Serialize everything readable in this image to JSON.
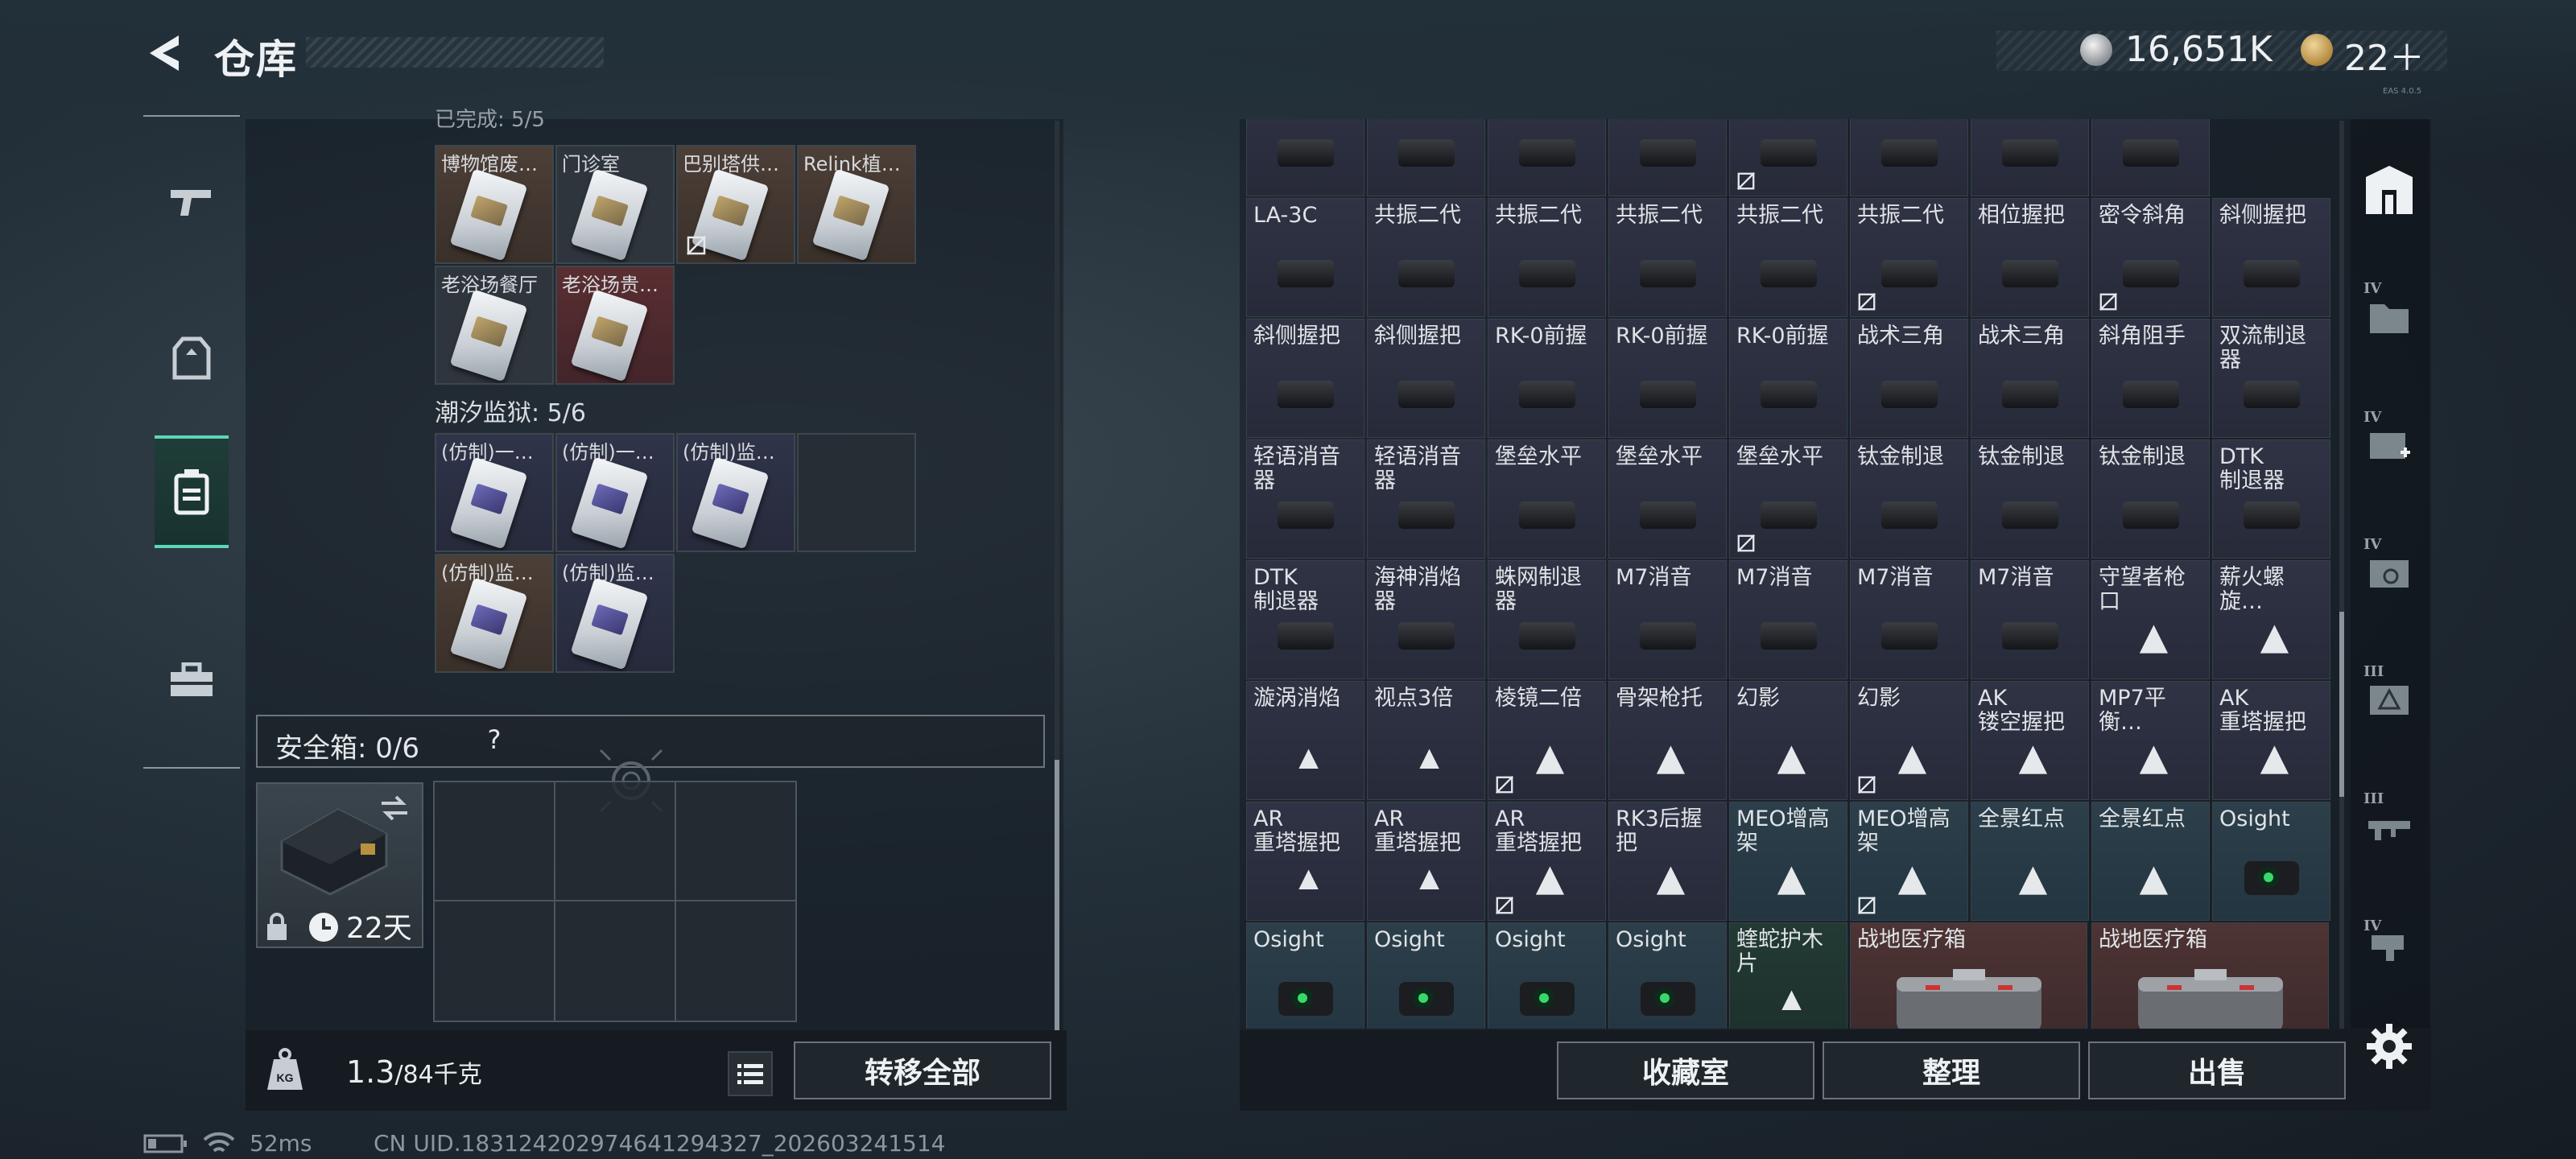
{
  "header": {
    "title": "仓库",
    "money": "16,651K",
    "gold": "22＋",
    "tiny_tag": "EAS 4.0.5"
  },
  "left_nav": {
    "items": [
      {
        "icon": "pistol-icon"
      },
      {
        "icon": "armor-vest-icon"
      },
      {
        "icon": "backpack-icon",
        "active": true
      },
      {
        "icon": "toolbox-icon"
      }
    ]
  },
  "left": {
    "top_section_label": "已完成: 5/5",
    "row1": [
      {
        "name": "博物馆废…",
        "color": "brown",
        "disabled": false
      },
      {
        "name": "门诊室",
        "color": "dark",
        "disabled": false
      },
      {
        "name": "巴别塔供…",
        "color": "brown",
        "disabled": true
      },
      {
        "name": "Relink植…",
        "color": "brown",
        "disabled": false
      }
    ],
    "row2": [
      {
        "name": "老浴场餐厅",
        "color": "dark",
        "disabled": false
      },
      {
        "name": "老浴场贵…",
        "color": "red",
        "disabled": false
      }
    ],
    "prison_label": "潮汐监狱: 5/6",
    "row3": [
      {
        "name": "(仿制)一…",
        "color": "navy"
      },
      {
        "name": "(仿制)一…",
        "color": "navy"
      },
      {
        "name": "(仿制)监…",
        "color": "navy"
      }
    ],
    "row4": [
      {
        "name": "(仿制)监…",
        "color": "brown"
      },
      {
        "name": "(仿制)监…",
        "color": "navy"
      }
    ],
    "safebox_label": "安全箱: 0/6",
    "safebox_help": "?",
    "case_days": "22天",
    "weight_value": "1.3",
    "weight_max": "/84千克",
    "transfer_all": "转移全部"
  },
  "grid": {
    "rows": [
      [
        {
          "n": "",
          "ic": "part"
        },
        {
          "n": "",
          "ic": "part"
        },
        {
          "n": "",
          "ic": "part"
        },
        {
          "n": "",
          "ic": "part"
        },
        {
          "n": "",
          "ic": "part",
          "x": 1
        },
        {
          "n": "",
          "ic": "part"
        },
        {
          "n": "",
          "ic": "part"
        },
        {
          "n": "",
          "ic": "part"
        }
      ],
      [
        {
          "n": "LA-3C",
          "ic": "part"
        },
        {
          "n": "共振二代",
          "ic": "part"
        },
        {
          "n": "共振二代",
          "ic": "part"
        },
        {
          "n": "共振二代",
          "ic": "part"
        },
        {
          "n": "共振二代",
          "ic": "part"
        },
        {
          "n": "共振二代",
          "ic": "part",
          "x": 1
        },
        {
          "n": "相位握把",
          "ic": "part"
        },
        {
          "n": "密令斜角",
          "ic": "part",
          "x": 1
        },
        {
          "n": "斜侧握把",
          "ic": "part"
        }
      ],
      [
        {
          "n": "斜侧握把",
          "ic": "part"
        },
        {
          "n": "斜侧握把",
          "ic": "part"
        },
        {
          "n": "RK-0前握",
          "ic": "part"
        },
        {
          "n": "RK-0前握",
          "ic": "part"
        },
        {
          "n": "RK-0前握",
          "ic": "part"
        },
        {
          "n": "战术三角",
          "ic": "part"
        },
        {
          "n": "战术三角",
          "ic": "part"
        },
        {
          "n": "斜角阻手",
          "ic": "part"
        },
        {
          "n": "双流制退器",
          "ic": "part"
        }
      ],
      [
        {
          "n": "轻语消音器",
          "ic": "part"
        },
        {
          "n": "轻语消音器",
          "ic": "part"
        },
        {
          "n": "堡垒水平",
          "ic": "part"
        },
        {
          "n": "堡垒水平",
          "ic": "part"
        },
        {
          "n": "堡垒水平",
          "ic": "part",
          "x": 1
        },
        {
          "n": "钛金制退",
          "ic": "part"
        },
        {
          "n": "钛金制退",
          "ic": "part"
        },
        {
          "n": "钛金制退",
          "ic": "part"
        },
        {
          "n": "DTK\n制退器",
          "ic": "part"
        }
      ],
      [
        {
          "n": "DTK\n制退器",
          "ic": "part"
        },
        {
          "n": "海神消焰器",
          "ic": "part"
        },
        {
          "n": "蛛网制退器",
          "ic": "part"
        },
        {
          "n": "M7消音",
          "ic": "part"
        },
        {
          "n": "M7消音",
          "ic": "part"
        },
        {
          "n": "M7消音",
          "ic": "part"
        },
        {
          "n": "M7消音",
          "ic": "part"
        },
        {
          "n": "守望者枪口",
          "ic": "tri"
        },
        {
          "n": "薪火螺旋…",
          "ic": "tri"
        }
      ],
      [
        {
          "n": "漩涡消焰",
          "ic": "tri-sm"
        },
        {
          "n": "视点3倍",
          "ic": "tri-sm"
        },
        {
          "n": "棱镜二倍",
          "ic": "tri",
          "x": 1
        },
        {
          "n": "骨架枪托",
          "ic": "tri"
        },
        {
          "n": "幻影",
          "ic": "tri"
        },
        {
          "n": "幻影",
          "ic": "tri",
          "x": 1
        },
        {
          "n": "AK\n镂空握把",
          "ic": "tri"
        },
        {
          "n": "MP7平衡…",
          "ic": "tri"
        },
        {
          "n": "AK\n重塔握把",
          "ic": "tri"
        }
      ],
      [
        {
          "n": "AR\n重塔握把",
          "ic": "tri-sm"
        },
        {
          "n": "AR\n重塔握把",
          "ic": "tri-sm"
        },
        {
          "n": "AR\n重塔握把",
          "ic": "tri",
          "x": 1
        },
        {
          "n": "RK3后握把",
          "ic": "tri"
        },
        {
          "n": "MEO增高架",
          "ic": "tri",
          "c": "teal"
        },
        {
          "n": "MEO增高架",
          "ic": "tri",
          "c": "teal",
          "x": 1
        },
        {
          "n": "全景红点",
          "ic": "tri",
          "c": "teal"
        },
        {
          "n": "全景红点",
          "ic": "tri",
          "c": "teal"
        },
        {
          "n": "Osight",
          "ic": "sight",
          "c": "teal"
        }
      ],
      [
        {
          "n": "Osight",
          "ic": "sight",
          "c": "teal"
        },
        {
          "n": "Osight",
          "ic": "sight",
          "c": "teal"
        },
        {
          "n": "Osight",
          "ic": "sight",
          "c": "teal"
        },
        {
          "n": "Osight",
          "ic": "sight",
          "c": "teal"
        },
        {
          "n": "蝰蛇护木片",
          "ic": "tri-sm",
          "c": "green"
        },
        {
          "n": "战地医疗箱",
          "ic": "medbox",
          "c": "red",
          "wide": 1
        },
        {
          "n": "战地医疗箱",
          "ic": "medbox",
          "c": "red",
          "wide": 1
        }
      ]
    ]
  },
  "bottom_right": {
    "collection": "收藏室",
    "sort": "整理",
    "sell": "出售"
  },
  "right_tabs": [
    {
      "roman": "",
      "icon": "vault-icon"
    },
    {
      "roman": "IV",
      "icon": "folder-icon"
    },
    {
      "roman": "IV",
      "icon": "medkit-icon"
    },
    {
      "roman": "IV",
      "icon": "case-icon"
    },
    {
      "roman": "III",
      "icon": "triangle-case-icon"
    },
    {
      "roman": "III",
      "icon": "rifle-icon"
    },
    {
      "roman": "IV",
      "icon": "grip-icon"
    }
  ],
  "status": {
    "ping": "52ms",
    "uid": "CN UID.183124202974641294327_202603241514"
  }
}
